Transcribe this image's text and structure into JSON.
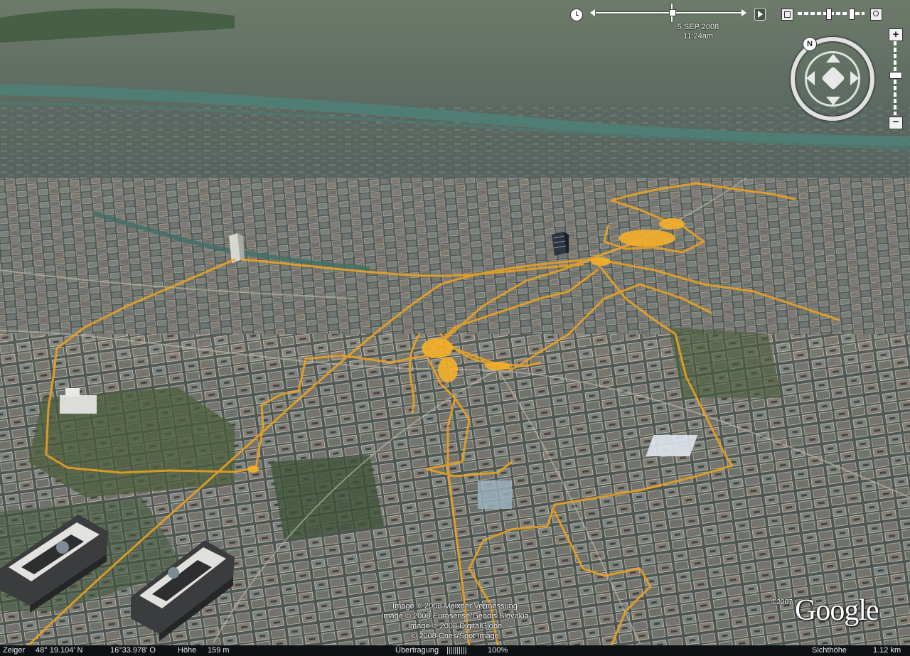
{
  "timeline": {
    "date": "5 SEP 2008",
    "time": "11:24am",
    "position": 0.51
  },
  "navigation": {
    "compass_label": "N",
    "zoom_in_label": "+",
    "zoom_out_label": "−",
    "zoom_level": 0.55
  },
  "credits": {
    "lines": [
      "Image © 2008 Meixner Vermessung",
      "Image © 2008 Eurosense/Geodis Slovakia",
      "Image © 2008 DigitalGlobe",
      "© 2008 Cnes/Spot Image"
    ],
    "copyright_year": "©2007",
    "logo": "Google"
  },
  "status": {
    "pointer_label": "Zeiger",
    "lat": "48° 19.104' N",
    "lon": "16°33.978' O",
    "elevation_label": "Höhe",
    "elevation": "159 m",
    "streaming_label": "Übertragung",
    "streaming_bars": "||||||||||",
    "streaming_value": "100%",
    "eye_alt_label": "Sichthöhe",
    "eye_alt": "1.12 km"
  },
  "colors": {
    "track": "#f0a420",
    "river": "#4f7f76"
  }
}
